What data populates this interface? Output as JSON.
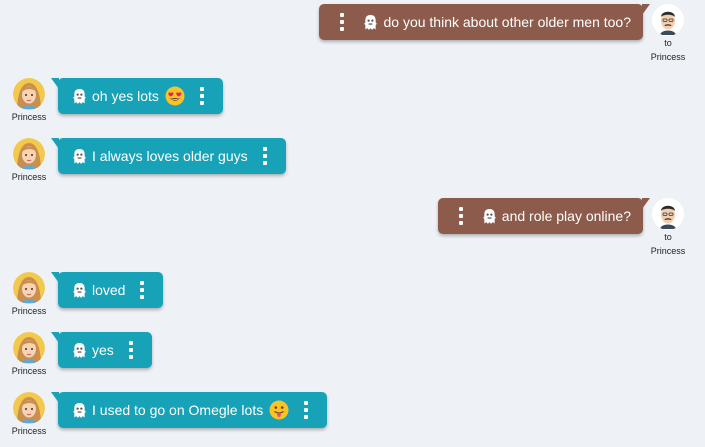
{
  "partner_name": "Princess",
  "sent_prefix": "to",
  "messages": [
    {
      "dir": "out",
      "text": "do you think about other older men too?",
      "emoji": ""
    },
    {
      "dir": "in",
      "text": "oh yes lots",
      "emoji": "heart-eyes-emoji"
    },
    {
      "dir": "in",
      "text": "I always loves older guys",
      "emoji": ""
    },
    {
      "dir": "out",
      "text": "and role play online?",
      "emoji": ""
    },
    {
      "dir": "in",
      "text": "loved",
      "emoji": ""
    },
    {
      "dir": "in",
      "text": "yes",
      "emoji": ""
    },
    {
      "dir": "in",
      "text": "I used to go on Omegle lots",
      "emoji": "tongue-out-emoji"
    }
  ],
  "colors": {
    "incoming_bubble": "#17a2b8",
    "outgoing_bubble": "#8d5b4c",
    "background": "#eef2f7"
  },
  "icons": {
    "message_icon": "ghost-icon",
    "menu_icon": "kebab-menu-icon"
  }
}
